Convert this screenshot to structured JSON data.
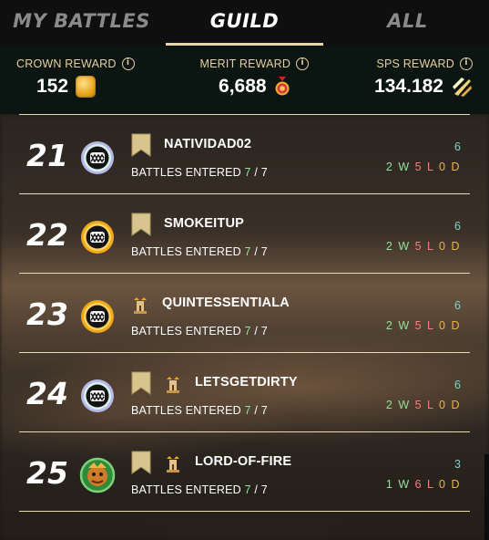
{
  "tabs": [
    {
      "label": "MY BATTLES",
      "active": false
    },
    {
      "label": "GUILD",
      "active": true
    },
    {
      "label": "ALL",
      "active": false
    }
  ],
  "rewards": {
    "crown": {
      "label": "CROWN REWARD",
      "value": "152",
      "icon": "crown-token-icon"
    },
    "merit": {
      "label": "MERIT REWARD",
      "value": "6,688",
      "icon": "merit-medal-icon"
    },
    "sps": {
      "label": "SPS REWARD",
      "value": "134.182",
      "icon": "sps-token-icon"
    }
  },
  "rows": [
    {
      "rank": "21",
      "name": "NATIVIDAD02",
      "badge": "silver",
      "flag": true,
      "tower": false,
      "battles_label": "BATTLES ENTERED",
      "entered": "7",
      "total": "7",
      "score": "6",
      "wins": "2",
      "losses": "5",
      "draws": "0"
    },
    {
      "rank": "22",
      "name": "SMOKEITUP",
      "badge": "gold",
      "flag": true,
      "tower": false,
      "battles_label": "BATTLES ENTERED",
      "entered": "7",
      "total": "7",
      "score": "6",
      "wins": "2",
      "losses": "5",
      "draws": "0"
    },
    {
      "rank": "23",
      "name": "QUINTESSENTIALA",
      "badge": "gold",
      "flag": false,
      "tower": true,
      "battles_label": "BATTLES ENTERED",
      "entered": "7",
      "total": "7",
      "score": "6",
      "wins": "2",
      "losses": "5",
      "draws": "0"
    },
    {
      "rank": "24",
      "name": "LETSGETDIRTY",
      "badge": "silver",
      "flag": true,
      "tower": true,
      "battles_label": "BATTLES ENTERED",
      "entered": "7",
      "total": "7",
      "score": "6",
      "wins": "2",
      "losses": "5",
      "draws": "0"
    },
    {
      "rank": "25",
      "name": "LORD-OF-FIRE",
      "badge": "avatar",
      "flag": true,
      "tower": true,
      "battles_label": "BATTLES ENTERED",
      "entered": "7",
      "total": "7",
      "score": "3",
      "wins": "1",
      "losses": "6",
      "draws": "0"
    }
  ],
  "labels": {
    "w": "W",
    "l": "L",
    "d": "D",
    "slash": "/",
    "info": "i"
  },
  "colors": {
    "accent": "#e8d6a6",
    "gold_label": "#e6cf9a",
    "win": "#8fe39a",
    "loss": "#ff7b7b",
    "draw": "#f0b441",
    "score": "#7fd2c8"
  }
}
